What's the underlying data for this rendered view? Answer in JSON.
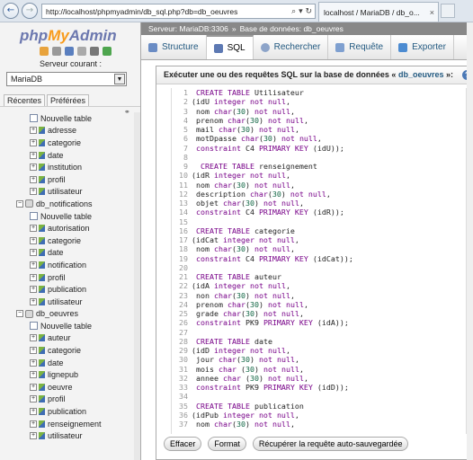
{
  "browser": {
    "back_glyph": "←",
    "forward_glyph": "→",
    "url": "http://localhost/phpmyadmin/db_sql.php?db=db_oeuvres",
    "url_controls": "⌕ ▾ ↻",
    "tab_title": "localhost / MariaDB / db_o...",
    "tab_close": "×"
  },
  "sidebar": {
    "logo_php": "php",
    "logo_my": "My",
    "logo_admin": "Admin",
    "server_label": "Serveur courant :",
    "server_value": "MariaDB",
    "tabs": [
      "Récentes",
      "Préférées"
    ],
    "tree": [
      {
        "type": "new",
        "label": "Nouvelle table"
      },
      {
        "type": "table",
        "label": "adresse"
      },
      {
        "type": "table",
        "label": "categorie"
      },
      {
        "type": "table",
        "label": "date"
      },
      {
        "type": "table",
        "label": "institution"
      },
      {
        "type": "table",
        "label": "profil"
      },
      {
        "type": "table",
        "label": "utilisateur"
      },
      {
        "type": "db",
        "label": "db_notifications"
      },
      {
        "type": "new",
        "label": "Nouvelle table"
      },
      {
        "type": "table",
        "label": "autorisation"
      },
      {
        "type": "table",
        "label": "categorie"
      },
      {
        "type": "table",
        "label": "date"
      },
      {
        "type": "table",
        "label": "notification"
      },
      {
        "type": "table",
        "label": "profil"
      },
      {
        "type": "table",
        "label": "publication"
      },
      {
        "type": "table",
        "label": "utilisateur"
      },
      {
        "type": "db",
        "label": "db_oeuvres"
      },
      {
        "type": "new",
        "label": "Nouvelle table"
      },
      {
        "type": "table",
        "label": "auteur"
      },
      {
        "type": "table",
        "label": "categorie"
      },
      {
        "type": "table",
        "label": "date"
      },
      {
        "type": "table",
        "label": "lignepub"
      },
      {
        "type": "table",
        "label": "oeuvre"
      },
      {
        "type": "table",
        "label": "profil"
      },
      {
        "type": "table",
        "label": "publication"
      },
      {
        "type": "table",
        "label": "renseignement"
      },
      {
        "type": "table",
        "label": "utilisateur"
      }
    ]
  },
  "main": {
    "breadcrumb_server": "Serveur: MariaDB:3306",
    "breadcrumb_sep": "»",
    "breadcrumb_db": "Base de données: db_oeuvres",
    "tabs": [
      "Structure",
      "SQL",
      "Rechercher",
      "Requête",
      "Exporter"
    ],
    "active_tab": "SQL",
    "legend_prefix": "Exécuter une ou des requêtes SQL sur la base de données «",
    "legend_db": "db_oeuvres",
    "legend_suffix": "»:",
    "sql_lines": [
      " CREATE TABLE Utilisateur",
      "(idU integer not null,",
      " nom char(30) not null,",
      " prenom char(30) not null,",
      " mail char(30) not null,",
      " motDpasse char(30) not null,",
      " constraint C4 PRIMARY KEY (idU));",
      "",
      "  CREATE TABLE renseignement",
      "(idR integer not null,",
      " nom char(30) not null,",
      " description char(30) not null,",
      " objet char(30) not null,",
      " constraint C4 PRIMARY KEY (idR));",
      "",
      " CREATE TABLE categorie",
      "(idCat integer not null,",
      " nom char(30) not null,",
      " constraint C4 PRIMARY KEY (idCat));",
      "",
      " CREATE TABLE auteur",
      "(idA integer not null,",
      " non char(30) not null,",
      " prenom char(30) not null,",
      " grade char(30) not null,",
      " constraint PK9 PRIMARY KEY (idA));",
      "",
      " CREATE TABLE date",
      "(idD integer not null,",
      " jour char(30) not null,",
      " mois char (30) not null,",
      " annee char (30) not null,",
      " constraint PK9 PRIMARY KEY (idD));",
      "",
      " CREATE TABLE publication",
      "(idPub integer not null,",
      " nom char(30) not null,"
    ],
    "buttons": [
      "Effacer",
      "Format",
      "Récupérer la requête auto-sauvegardée"
    ]
  },
  "colors": {
    "keyword": "#770088",
    "number": "#116644",
    "link": "#235a81"
  }
}
